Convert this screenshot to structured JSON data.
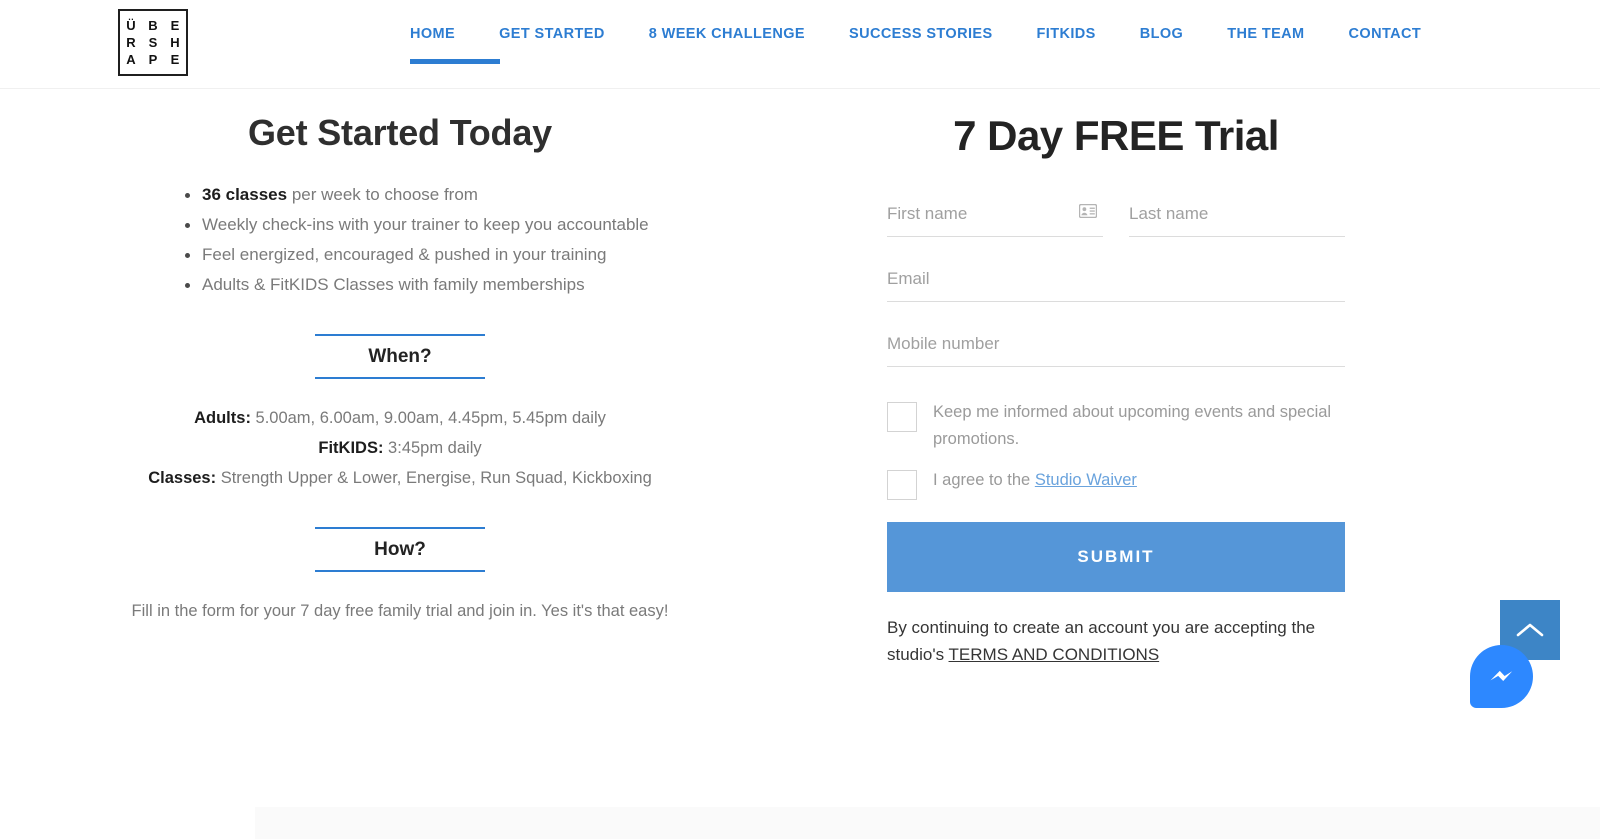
{
  "header": {
    "logo": {
      "name": "uber-shape-logo",
      "rows": [
        [
          "Ü",
          "B",
          "E"
        ],
        [
          "R",
          "S",
          "H"
        ],
        [
          "A",
          "P",
          "E"
        ]
      ]
    },
    "nav": [
      {
        "label": "HOME",
        "active": true
      },
      {
        "label": "GET STARTED",
        "active": false
      },
      {
        "label": "8 WEEK CHALLENGE",
        "active": false
      },
      {
        "label": "SUCCESS STORIES",
        "active": false
      },
      {
        "label": "FITKIDS",
        "active": false
      },
      {
        "label": "BLOG",
        "active": false
      },
      {
        "label": "THE TEAM",
        "active": false
      },
      {
        "label": "CONTACT",
        "active": false
      }
    ],
    "accent_color": "#2d7dd2"
  },
  "left": {
    "title": "Get Started Today",
    "benefits": [
      {
        "bold": "36 classes",
        "rest": " per week to choose from"
      },
      {
        "bold": "",
        "rest": "Weekly check-ins with your trainer to keep you accountable"
      },
      {
        "bold": "",
        "rest": "Feel energized, encouraged & pushed in your training"
      },
      {
        "bold": "",
        "rest": "Adults & FitKIDS Classes with family memberships"
      }
    ],
    "when_heading": "When?",
    "schedule": [
      {
        "label": "Adults:",
        "value": " 5.00am, 6.00am, 9.00am, 4.45pm, 5.45pm daily"
      },
      {
        "label": "FitKIDS:",
        "value": " 3:45pm daily"
      },
      {
        "label": "Classes:",
        "value": " Strength Upper & Lower, Energise, Run Squad, Kickboxing"
      }
    ],
    "how_heading": "How?",
    "how_copy": "Fill in the form for your 7 day free family trial and join in. Yes it's that easy!"
  },
  "form": {
    "title": "7 Day FREE Trial",
    "first_name": {
      "placeholder": "First name",
      "value": ""
    },
    "last_name": {
      "placeholder": "Last name",
      "value": ""
    },
    "email": {
      "placeholder": "Email",
      "value": ""
    },
    "mobile": {
      "placeholder": "Mobile number",
      "value": ""
    },
    "autofill_icon": "contact-card-icon",
    "checkbox_marketing": {
      "label": "Keep me informed about upcoming events and special promotions.",
      "checked": false
    },
    "checkbox_waiver": {
      "label_before": "I agree to the ",
      "link_text": "Studio Waiver",
      "checked": false
    },
    "submit_label": "SUBMIT",
    "submit_color": "#5596d8",
    "legal_before": "By continuing to create an account you are accepting the studio's ",
    "legal_link": "TERMS AND CONDITIONS"
  },
  "widgets": {
    "scroll_top": {
      "name": "scroll-to-top-button",
      "color": "#3d85c6"
    },
    "messenger": {
      "name": "facebook-messenger-button",
      "color": "#2d88ff"
    }
  }
}
